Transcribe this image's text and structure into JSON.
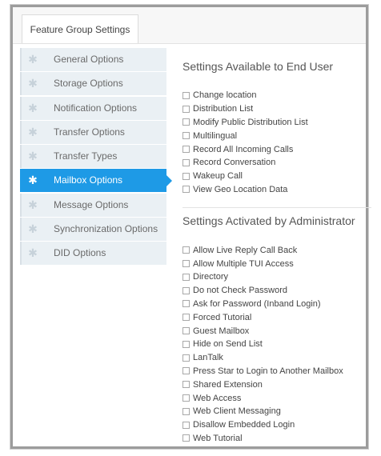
{
  "header": {
    "tab_label": "Feature Group Settings"
  },
  "sidebar": {
    "items": [
      {
        "label": "General Options",
        "active": false
      },
      {
        "label": "Storage Options",
        "active": false
      },
      {
        "label": "Notification Options",
        "active": false
      },
      {
        "label": "Transfer Options",
        "active": false
      },
      {
        "label": "Transfer Types",
        "active": false
      },
      {
        "label": "Mailbox Options",
        "active": true
      },
      {
        "label": "Message Options",
        "active": false
      },
      {
        "label": "Synchronization Options",
        "active": false
      },
      {
        "label": "DID Options",
        "active": false
      }
    ],
    "icon": "gear-icon",
    "active_color": "#1e9ae6"
  },
  "main": {
    "end_user": {
      "title": "Settings Available to End User",
      "options": [
        "Change location",
        "Distribution List",
        "Modify Public Distribution List",
        "Multilingual",
        "Record All Incoming Calls",
        "Record Conversation",
        "Wakeup Call",
        "View Geo Location Data"
      ]
    },
    "admin": {
      "title": "Settings Activated by Administrator",
      "options": [
        "Allow Live Reply Call Back",
        "Allow Multiple TUI Access",
        "Directory",
        "Do not Check Password",
        "Ask for Password (Inband Login)",
        "Forced Tutorial",
        "Guest Mailbox",
        "Hide on Send List",
        "LanTalk",
        "Press Star to Login to Another Mailbox",
        "Shared Extension",
        "Web Access",
        "Web Client Messaging",
        "Disallow Embedded Login",
        "Web Tutorial"
      ]
    }
  }
}
